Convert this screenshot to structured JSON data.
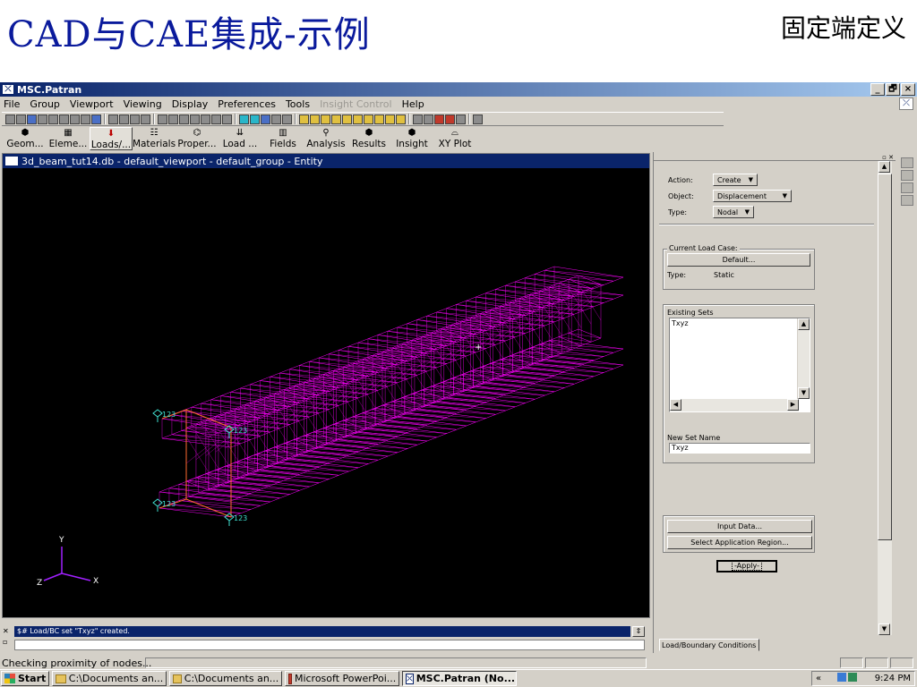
{
  "slide": {
    "title": "CAD与CAE集成-示例",
    "corner_label": "固定端定义"
  },
  "window": {
    "title": "MSC.Patran",
    "buttons": [
      "_",
      "🗗",
      "×"
    ]
  },
  "menu": {
    "items": [
      "File",
      "Group",
      "Viewport",
      "Viewing",
      "Display",
      "Preferences",
      "Tools"
    ],
    "disabled_item": "Insight Control",
    "help": "Help"
  },
  "app_tabs": [
    {
      "label": "Geom...",
      "icon": "geometry-icon",
      "glyph": "⬢"
    },
    {
      "label": "Eleme...",
      "icon": "elements-icon",
      "glyph": "▦"
    },
    {
      "label": "Loads/...",
      "icon": "loads-icon",
      "glyph": "⬇"
    },
    {
      "label": "Materials",
      "icon": "materials-icon",
      "glyph": "☷"
    },
    {
      "label": "Proper...",
      "icon": "properties-icon",
      "glyph": "⌬"
    },
    {
      "label": "Load ...",
      "icon": "load-case-icon",
      "glyph": "⇊"
    },
    {
      "label": "Fields",
      "icon": "fields-icon",
      "glyph": "▥"
    },
    {
      "label": "Analysis",
      "icon": "analysis-icon",
      "glyph": "⚲"
    },
    {
      "label": "Results",
      "icon": "results-icon",
      "glyph": "⬢"
    },
    {
      "label": "Insight",
      "icon": "insight-icon",
      "glyph": "⬢"
    },
    {
      "label": "XY Plot",
      "icon": "xy-plot-icon",
      "glyph": "⌓"
    }
  ],
  "active_tab": "Loads/...",
  "viewport": {
    "title": "3d_beam_tut14.db - default_viewport - default_group - Entity",
    "axis_labels": {
      "x": "X",
      "y": "Y",
      "z": "Z"
    },
    "bc_marker_label": "123",
    "mesh_color": "#ff00ff",
    "background": "#000000"
  },
  "console": {
    "message": "$# Load/BC set \"Txyz\" created."
  },
  "status": {
    "text": "Checking proximity of nodes..."
  },
  "panel": {
    "action_label": "Action:",
    "action_value": "Create",
    "object_label": "Object:",
    "object_value": "Displacement",
    "type_label": "Type:",
    "type_value": "Nodal",
    "current_load_case_label": "Current Load Case:",
    "load_case_button": "Default...",
    "lc_type_label": "Type:",
    "lc_type_value": "Static",
    "existing_sets_label": "Existing Sets",
    "existing_sets": [
      "Txyz"
    ],
    "new_set_name_label": "New Set Name",
    "new_set_name_value": "Txyz",
    "input_data_button": "Input Data...",
    "select_region_button": "Select Application Region...",
    "apply_button": "-Apply-",
    "footer_tab": "Load/Boundary Conditions"
  },
  "taskbar": {
    "start": "Start",
    "tasks": [
      {
        "label": "C:\\Documents an...",
        "icon": "folder-icon"
      },
      {
        "label": "C:\\Documents an...",
        "icon": "folder-icon"
      },
      {
        "label": "Microsoft PowerPoi...",
        "icon": "powerpoint-icon"
      },
      {
        "label": "MSC.Patran (No...",
        "icon": "patran-icon"
      }
    ],
    "tray_chevron": "«",
    "clock": "9:24 PM"
  }
}
